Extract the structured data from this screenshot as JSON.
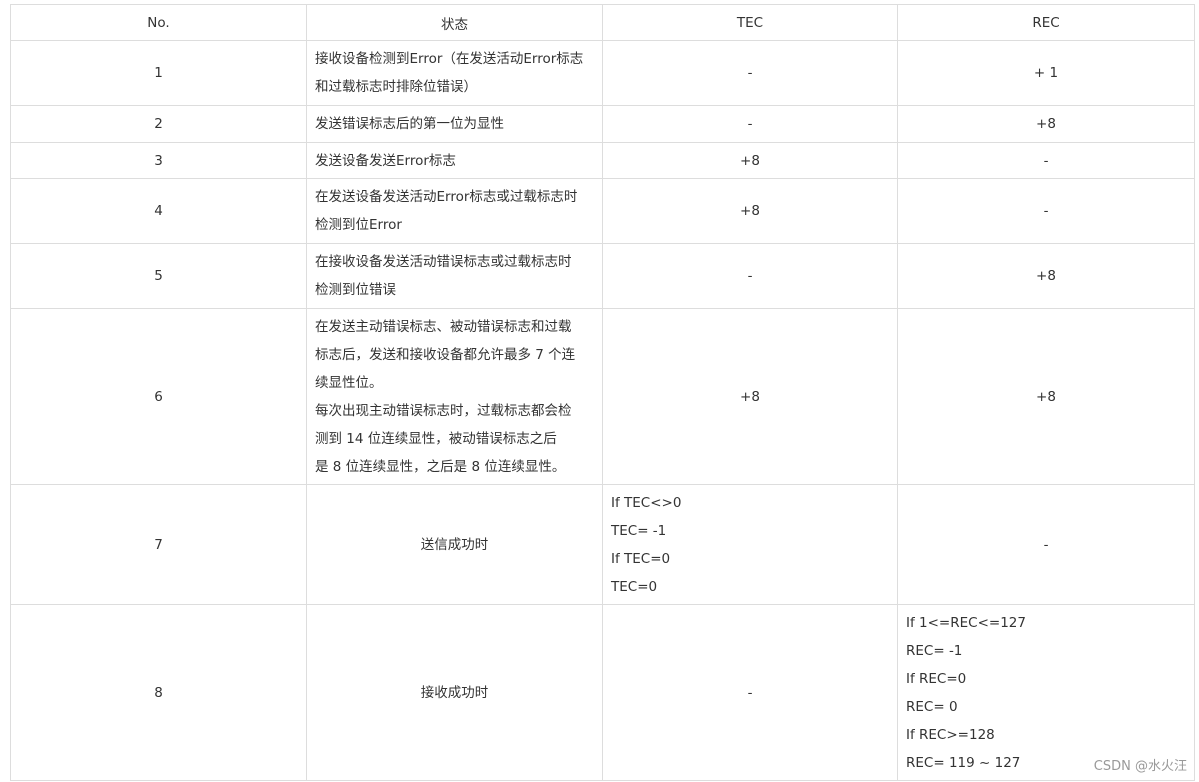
{
  "table": {
    "headers": [
      "No.",
      "状态",
      "TEC",
      "REC"
    ],
    "rows": [
      {
        "no": "1",
        "status": [
          "接收设备检测到Error（在发送活动Error标志",
          "和过载标志时排除位错误）"
        ],
        "tec": [
          "-"
        ],
        "rec": [
          "+ 1"
        ]
      },
      {
        "no": "2",
        "status": [
          "发送错误标志后的第一位为显性"
        ],
        "tec": [
          "-"
        ],
        "rec": [
          "+8"
        ]
      },
      {
        "no": "3",
        "status": [
          "发送设备发送Error标志"
        ],
        "tec": [
          "+8"
        ],
        "rec": [
          "-"
        ]
      },
      {
        "no": "4",
        "status": [
          "在发送设备发送活动Error标志或过载标志时",
          "检测到位Error"
        ],
        "tec": [
          "+8"
        ],
        "rec": [
          "-"
        ]
      },
      {
        "no": "5",
        "status": [
          "在接收设备发送活动错误标志或过载标志时",
          "检测到位错误"
        ],
        "tec": [
          "-"
        ],
        "rec": [
          "+8"
        ]
      },
      {
        "no": "6",
        "status": [
          "在发送主动错误标志、被动错误标志和过载",
          "标志后，发送和接收设备都允许最多 7 个连",
          "续显性位。",
          "每次出现主动错误标志时，过载标志都会检",
          "测到 14 位连续显性，被动错误标志之后",
          "是 8 位连续显性，之后是 8 位连续显性。"
        ],
        "tec": [
          "+8"
        ],
        "rec": [
          "+8"
        ]
      },
      {
        "no": "7",
        "status": [
          "送信成功时"
        ],
        "tec": [
          "If TEC<>0",
          "TEC= -1",
          "If TEC=0",
          "TEC=0"
        ],
        "rec": [
          "-"
        ]
      },
      {
        "no": "8",
        "status": [
          "接收成功时"
        ],
        "tec": [
          "-"
        ],
        "rec": [
          "If 1<=REC<=127",
          "REC= -1",
          "If REC=0",
          "REC= 0",
          "If REC>=128",
          "REC= 119 ~ 127"
        ]
      }
    ]
  },
  "watermark": "CSDN @水火汪"
}
